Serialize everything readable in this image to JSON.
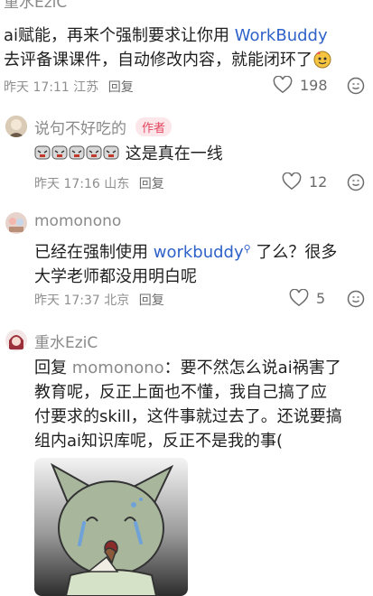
{
  "comments": [
    {
      "author": "重水EziC",
      "text": "ai赋能，再来个强制要求让你用 WorkBuddy 去评备课课件，自动修改内容，就能闭环了",
      "line1_pre": "ai赋能，再来个强制要求让你用 ",
      "line1_link": "WorkBuddy",
      "line2": "去评备课课件，自动修改内容，就能闭环了",
      "time": "昨天 17:11",
      "location": "江苏",
      "reply_label": "回复",
      "likes": "198"
    },
    {
      "author": "说句不好吃的",
      "badge": "作者",
      "text": "这是真在一线",
      "time": "昨天 17:16",
      "location": "山东",
      "reply_label": "回复",
      "likes": "12"
    },
    {
      "author": "momonono",
      "line1_pre": "已经在强制使用 ",
      "line1_link": "workbuddy",
      "line1_post": " 了么？很多",
      "line2": "大学老师都没用明白呢",
      "time": "昨天 17:37",
      "location": "北京",
      "reply_label": "回复",
      "likes": "5"
    },
    {
      "author": "重水EziC",
      "reply_prefix": "回复",
      "reply_to": "momonono",
      "line1_post": "：要不然怎么说ai祸害了",
      "line2": "教育呢，反正上面也不懂，我自己搞了应",
      "line3": "付要求的skill，这件事就过去了。还说要搞",
      "line4": "组内ai知识库呢，反正不是我的事("
    }
  ],
  "colors": {
    "link": "#2f62c9",
    "badge_bg": "#fde6ea",
    "badge_text": "#e3465f"
  }
}
